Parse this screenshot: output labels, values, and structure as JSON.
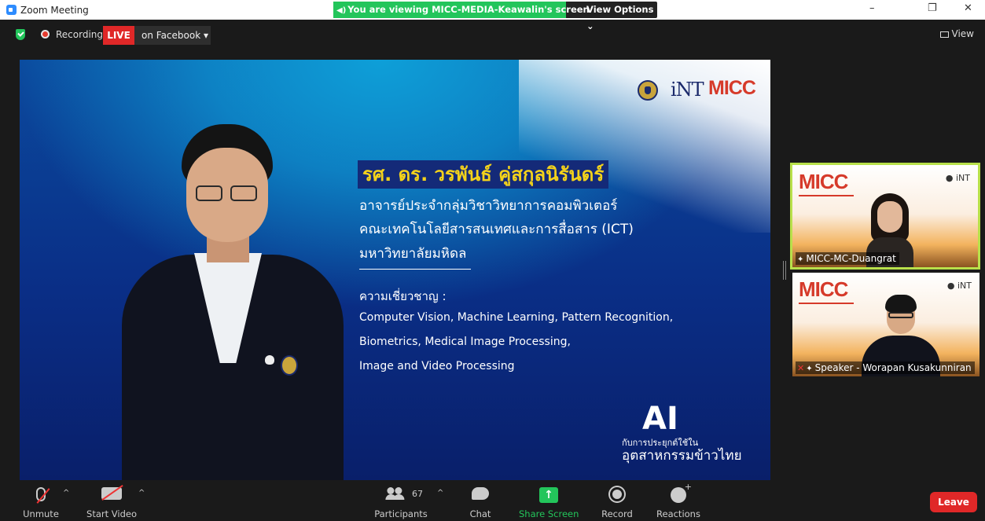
{
  "window": {
    "title": "Zoom Meeting",
    "share_banner": "You are viewing MICC-MEDIA-Keawalin's screen",
    "view_options": "View Options",
    "minimize": "–",
    "restore": "❐",
    "close": "✕"
  },
  "meeting": {
    "recording_label": "Recording",
    "live_badge": "LIVE",
    "live_destination": "on Facebook",
    "view_label": "View"
  },
  "slide": {
    "logo_int": "iNT",
    "logo_micc": "MICC",
    "title": "รศ. ดร. วรพันธ์ คู่สกุลนิรันดร์",
    "affiliation": [
      "อาจารย์ประจำกลุ่มวิชาวิทยาการคอมพิวเตอร์",
      "คณะเทคโนโลยีสารสนเทศและการสื่อสาร (ICT)",
      "มหาวิทยาลัยมหิดล"
    ],
    "expertise_label": "ความเชี่ยวชาญ :",
    "expertise": [
      "Computer Vision, Machine Learning, Pattern Recognition,",
      "Biometrics, Medical Image Processing,",
      "Image and Video Processing"
    ],
    "ai_title": "AI",
    "ai_sub1": "กับการประยุกต์ใช้ใน",
    "ai_sub2": "อุตสาหกรรมข้าวไทย"
  },
  "participants_tiles": [
    {
      "logo": "MICC",
      "logos_right": "● iNT",
      "name": "MICC-MC-Duangrat",
      "active": true
    },
    {
      "logo": "MICC",
      "logos_right": "● iNT",
      "name": "Speaker - Worapan Kusakunniran",
      "active": false
    }
  ],
  "toolbar": {
    "unmute": "Unmute",
    "start_video": "Start Video",
    "participants": "Participants",
    "participants_count": "67",
    "chat": "Chat",
    "share_screen": "Share Screen",
    "record": "Record",
    "reactions": "Reactions",
    "leave": "Leave",
    "caret": "^"
  },
  "colors": {
    "share_green": "#23c55b",
    "live_red": "#e02828",
    "slide_title_yellow": "#f3d21b",
    "active_tile_border": "#b8e04a"
  },
  "icons": [
    "zoom-app-icon",
    "shield-icon",
    "record-icon",
    "speaker-icon",
    "grid-icon",
    "mic-muted-icon",
    "video-off-icon",
    "participants-icon",
    "chat-icon",
    "share-screen-icon",
    "record-button-icon",
    "reactions-icon",
    "pin-icon"
  ]
}
